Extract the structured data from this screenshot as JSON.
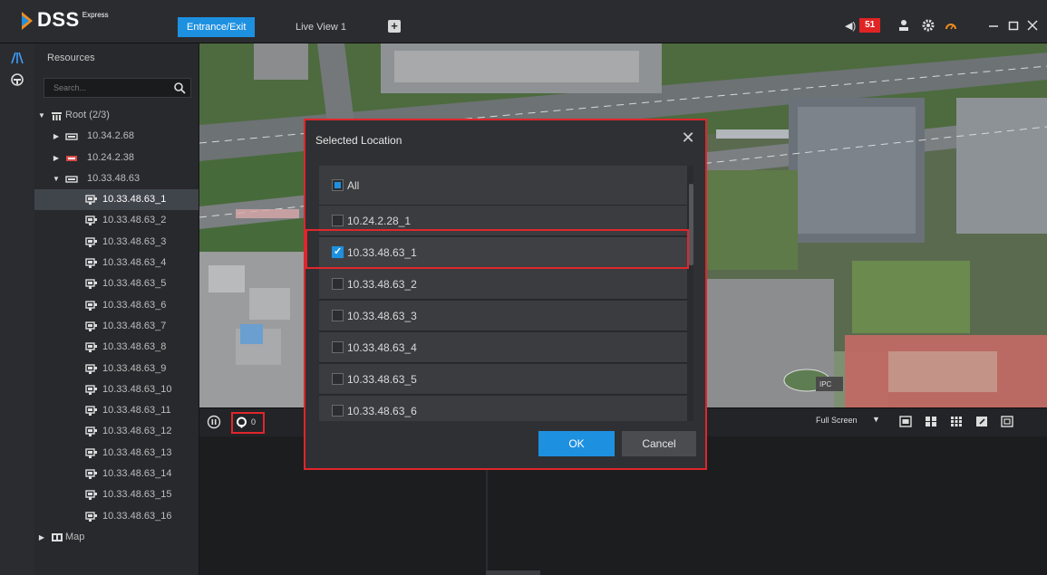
{
  "app": {
    "logo_text": "DSS",
    "logo_sup": "Express",
    "tabs": [
      {
        "label": "Entrance/Exit",
        "active": true
      },
      {
        "label": "Live View 1",
        "active": false
      }
    ],
    "add_tab_icon": "plus-icon",
    "alarm_count": "51",
    "accent": "#1e90e0",
    "highlight": "#e0262c"
  },
  "sidebar": {
    "title": "Resources",
    "search_placeholder": "Search...",
    "tree": [
      {
        "label": "Root (2/3)",
        "level": 0,
        "expanded": true,
        "icon": "root-icon"
      },
      {
        "label": "10.34.2.68",
        "level": 1,
        "expanded": false,
        "icon": "device-icon"
      },
      {
        "label": "10.24.2.38",
        "level": 1,
        "expanded": false,
        "icon": "device-offline-icon"
      },
      {
        "label": "10.33.48.63",
        "level": 1,
        "expanded": true,
        "icon": "device-icon"
      },
      {
        "label": "10.33.48.63_1",
        "level": 2,
        "selected": true,
        "icon": "camera-icon"
      },
      {
        "label": "10.33.48.63_2",
        "level": 2,
        "icon": "camera-icon"
      },
      {
        "label": "10.33.48.63_3",
        "level": 2,
        "icon": "camera-icon"
      },
      {
        "label": "10.33.48.63_4",
        "level": 2,
        "icon": "camera-icon"
      },
      {
        "label": "10.33.48.63_5",
        "level": 2,
        "icon": "camera-icon"
      },
      {
        "label": "10.33.48.63_6",
        "level": 2,
        "icon": "camera-icon"
      },
      {
        "label": "10.33.48.63_7",
        "level": 2,
        "icon": "camera-icon"
      },
      {
        "label": "10.33.48.63_8",
        "level": 2,
        "icon": "camera-icon"
      },
      {
        "label": "10.33.48.63_9",
        "level": 2,
        "icon": "camera-icon"
      },
      {
        "label": "10.33.48.63_10",
        "level": 2,
        "icon": "camera-icon"
      },
      {
        "label": "10.33.48.63_11",
        "level": 2,
        "icon": "camera-icon"
      },
      {
        "label": "10.33.48.63_12",
        "level": 2,
        "icon": "camera-icon"
      },
      {
        "label": "10.33.48.63_13",
        "level": 2,
        "icon": "camera-icon"
      },
      {
        "label": "10.33.48.63_14",
        "level": 2,
        "icon": "camera-icon"
      },
      {
        "label": "10.33.48.63_15",
        "level": 2,
        "icon": "camera-icon"
      },
      {
        "label": "10.33.48.63_16",
        "level": 2,
        "icon": "camera-icon"
      },
      {
        "label": "Map",
        "level": 0,
        "expanded": false,
        "icon": "map-icon"
      }
    ]
  },
  "toolstrip": {
    "location_count": "0",
    "full_screen_label": "Full Screen"
  },
  "dialog": {
    "title": "Selected Location",
    "items": [
      {
        "label": "All",
        "state": "partial"
      },
      {
        "label": "10.24.2.28_1",
        "state": "off"
      },
      {
        "label": "10.33.48.63_1",
        "state": "on"
      },
      {
        "label": "10.33.48.63_2",
        "state": "off"
      },
      {
        "label": "10.33.48.63_3",
        "state": "off"
      },
      {
        "label": "10.33.48.63_4",
        "state": "off"
      },
      {
        "label": "10.33.48.63_5",
        "state": "off"
      },
      {
        "label": "10.33.48.63_6",
        "state": "off"
      }
    ],
    "ok_label": "OK",
    "cancel_label": "Cancel"
  },
  "map_labels": {
    "ipc_marker": "IPC"
  }
}
